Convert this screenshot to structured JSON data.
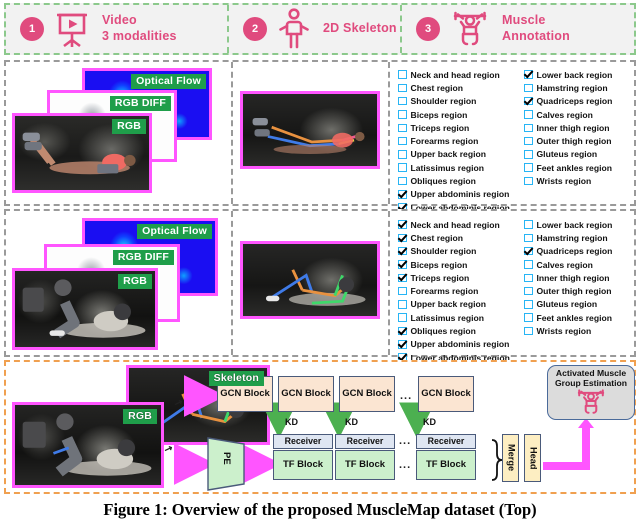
{
  "header": {
    "items": [
      {
        "number": "1",
        "icon": "video-projector-icon",
        "lines": [
          "Video",
          "3 modalities"
        ]
      },
      {
        "number": "2",
        "icon": "standing-person-icon",
        "lines": [
          "2D Skeleton"
        ]
      },
      {
        "number": "3",
        "icon": "weightlifter-icon",
        "lines": [
          "Muscle",
          "Annotation"
        ]
      }
    ]
  },
  "colors": {
    "accent_pink": "#e04b7e",
    "header_dash_green": "#8cc98c",
    "row_dash_gray": "#9a9a9a",
    "pipeline_dash_orange": "#f0a050",
    "card_border_magenta": "#ff55ff",
    "tag_green": "#1f9e4a",
    "checkbox_blue": "#27b5f5",
    "gcn_fill": "#fbe5d2",
    "tf_fill": "#ccf0cc",
    "receiver_fill": "#dfe6f2",
    "merge_head_fill": "#fdeec2",
    "estimation_fill": "#dcdcdc",
    "arrow_magenta": "#ff55ff",
    "kd_arrow_green": "#4cb050"
  },
  "samples": [
    {
      "modality_tags": [
        "Optical Flow",
        "RGB DIFF",
        "RGB"
      ],
      "skeleton_tag": "",
      "checkboxes": {
        "left": [
          {
            "label": "Neck and head region",
            "checked": false
          },
          {
            "label": "Chest region",
            "checked": false
          },
          {
            "label": "Shoulder region",
            "checked": false
          },
          {
            "label": "Biceps region",
            "checked": false
          },
          {
            "label": "Triceps region",
            "checked": false
          },
          {
            "label": "Forearms region",
            "checked": false
          },
          {
            "label": "Upper back region",
            "checked": false
          },
          {
            "label": "Latissimus region",
            "checked": false
          },
          {
            "label": "Obliques region",
            "checked": false
          },
          {
            "label": "Upper abdominis region",
            "checked": true
          },
          {
            "label": "Lower abdominis region",
            "checked": true
          }
        ],
        "right": [
          {
            "label": "Lower back region",
            "checked": true
          },
          {
            "label": "Hamstring region",
            "checked": false
          },
          {
            "label": "Quadriceps region",
            "checked": true
          },
          {
            "label": "Calves region",
            "checked": false
          },
          {
            "label": "Inner thigh region",
            "checked": false
          },
          {
            "label": "Outer thigh region",
            "checked": false
          },
          {
            "label": "Gluteus region",
            "checked": false
          },
          {
            "label": "Feet ankles region",
            "checked": false
          },
          {
            "label": "Wrists region",
            "checked": false
          }
        ]
      }
    },
    {
      "modality_tags": [
        "Optical Flow",
        "RGB DIFF",
        "RGB"
      ],
      "skeleton_tag": "",
      "checkboxes": {
        "left": [
          {
            "label": "Neck and head region",
            "checked": true
          },
          {
            "label": "Chest region",
            "checked": true
          },
          {
            "label": "Shoulder region",
            "checked": true
          },
          {
            "label": "Biceps region",
            "checked": true
          },
          {
            "label": "Triceps region",
            "checked": true
          },
          {
            "label": "Forearms region",
            "checked": false
          },
          {
            "label": "Upper back region",
            "checked": false
          },
          {
            "label": "Latissimus region",
            "checked": false
          },
          {
            "label": "Obliques region",
            "checked": true
          },
          {
            "label": "Upper abdominis region",
            "checked": true
          },
          {
            "label": "Lower abdominis region",
            "checked": true
          }
        ],
        "right": [
          {
            "label": "Lower back region",
            "checked": false
          },
          {
            "label": "Hamstring region",
            "checked": false
          },
          {
            "label": "Quadriceps region",
            "checked": true
          },
          {
            "label": "Calves region",
            "checked": false
          },
          {
            "label": "Inner thigh region",
            "checked": false
          },
          {
            "label": "Outer thigh region",
            "checked": false
          },
          {
            "label": "Gluteus region",
            "checked": false
          },
          {
            "label": "Feet ankles region",
            "checked": false
          },
          {
            "label": "Wrists region",
            "checked": false
          }
        ]
      }
    }
  ],
  "pipeline": {
    "input_tags": [
      "Skeleton",
      "RGB"
    ],
    "gcn_blocks": [
      "GCN Block",
      "GCN Block",
      "GCN Block",
      "GCN Block"
    ],
    "gcn_ellipsis": "...",
    "kd_labels": [
      "KD",
      "KD",
      "KD"
    ],
    "pe_label": "PE",
    "receiver_blocks": [
      "Receiver",
      "Receiver",
      "Receiver"
    ],
    "receiver_ellipsis": "...",
    "tf_blocks": [
      "TF Block",
      "TF Block",
      "TF Block"
    ],
    "tf_ellipsis": "...",
    "merge_label": "Merge",
    "head_label": "Head",
    "estimation": {
      "line1": "Activated Muscle",
      "line2": "Group Estimation",
      "icon": "weightlifter-icon"
    }
  },
  "caption": "Figure 1: Overview of the proposed MuscleMap dataset (Top)"
}
